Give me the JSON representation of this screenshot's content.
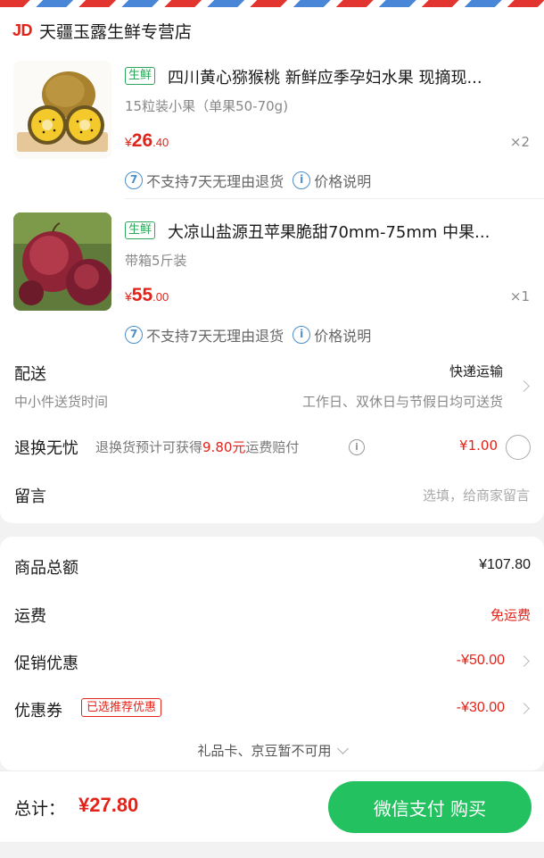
{
  "shop": {
    "logo": "JD",
    "name": "天疆玉露生鲜专营店"
  },
  "products": [
    {
      "tag": "生鲜",
      "title": "四川黄心猕猴桃 新鲜应季孕妇水果 现摘现...",
      "spec": "15粒装小果（单果50-70g)",
      "price_currency": "¥",
      "price_yuan": "26",
      "price_cent": ".40",
      "qty": "×2",
      "no_return": "不支持7天无理由退货",
      "price_note": "价格说明",
      "image_icon": "kiwi-photo"
    },
    {
      "tag": "生鲜",
      "title": "大凉山盐源丑苹果脆甜70mm-75mm 中果...",
      "spec": "带箱5斤装",
      "price_currency": "¥",
      "price_yuan": "55",
      "price_cent": ".00",
      "qty": "×1",
      "no_return": "不支持7天无理由退货",
      "price_note": "价格说明",
      "image_icon": "apple-photo"
    }
  ],
  "delivery": {
    "label": "配送",
    "method": "快递运输",
    "sub": "中小件送货时间",
    "time": "工作日、双休日与节假日均可送货"
  },
  "return_worry": {
    "label": "退换无忧",
    "desc_prefix": "退换货预计可获得",
    "desc_amount": "9.80元",
    "desc_suffix": "运费赔付",
    "price": "¥1.00"
  },
  "message": {
    "label": "留言",
    "placeholder": "选填，给商家留言"
  },
  "summary": {
    "goods_total_label": "商品总额",
    "goods_total": "¥107.80",
    "shipping_label": "运费",
    "shipping": "免运费",
    "promo_label": "促销优惠",
    "promo": "-¥50.00",
    "coupon_label": "优惠券",
    "coupon_badge": "已选推荐优惠",
    "coupon": "-¥30.00",
    "gift_note": "礼品卡、京豆暂不可用"
  },
  "footer": {
    "total_label": "总计：",
    "total": "¥27.80",
    "pay_button": "微信支付 购买"
  },
  "colors": {
    "accent": "#e2231a",
    "green": "#23c15f",
    "tag_green": "#2ba65a",
    "info_blue": "#4b8ec9"
  }
}
